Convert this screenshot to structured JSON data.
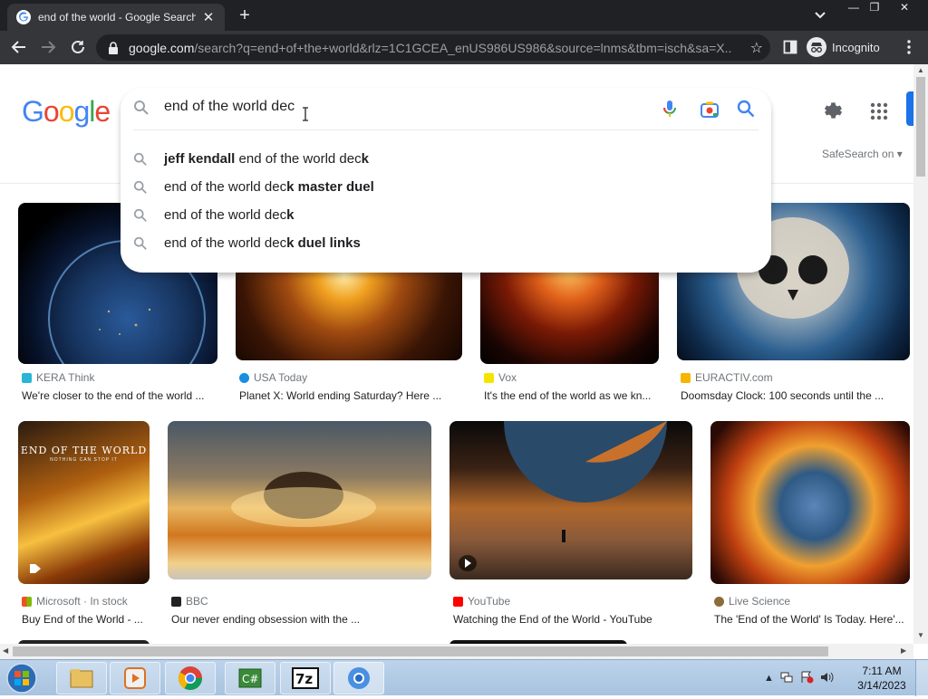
{
  "browser": {
    "tab_title": "end of the world - Google Search",
    "tab_close": "✕",
    "new_tab": "+",
    "url_host": "google.com",
    "url_path": "/search?q=end+of+the+world&rlz=1C1GCEA_enUS986US986&source=lnms&tbm=isch&sa=X...",
    "incognito_label": "Incognito",
    "window_controls": [
      "—",
      "❐",
      "✕"
    ]
  },
  "google": {
    "logo_letters": [
      "G",
      "o",
      "o",
      "g",
      "l",
      "e"
    ],
    "logo_colors": [
      "#4285F4",
      "#EA4335",
      "#FBBC05",
      "#4285F4",
      "#34A853",
      "#EA4335"
    ],
    "search_value": "end of the world dec",
    "safesearch_label": "SafeSearch on ▾",
    "suggestions": [
      {
        "bold_prefix": "jeff kendall",
        "normal": " end of the world dec",
        "bold_suffix": "k"
      },
      {
        "bold_prefix": "",
        "normal": "end of the world dec",
        "bold_suffix": "k master duel"
      },
      {
        "bold_prefix": "",
        "normal": "end of the world dec",
        "bold_suffix": "k"
      },
      {
        "bold_prefix": "",
        "normal": "end of the world dec",
        "bold_suffix": "k duel links"
      }
    ]
  },
  "results": [
    {
      "source": "KERA Think",
      "caption": "We're closer to the end of the world ...",
      "fav_color": "#29b6d6"
    },
    {
      "source": "USA Today",
      "caption": "Planet X: World ending Saturday? Here ...",
      "fav_color": "#1a8ee0"
    },
    {
      "source": "Vox",
      "caption": "It's the end of the world as we kn...",
      "fav_color": "#f5e400"
    },
    {
      "source": "EURACTIV.com",
      "caption": "Doomsday Clock: 100 seconds until the ...",
      "fav_color": "#f7b500"
    },
    {
      "source": "Microsoft · In stock",
      "caption": "Buy End of the World - ...",
      "fav_color": "#f25022"
    },
    {
      "source": "BBC",
      "caption": "Our never ending obsession with the ...",
      "fav_color": "#222222"
    },
    {
      "source": "YouTube",
      "caption": "Watching the End of the World - YouTube",
      "fav_color": "#ff0000"
    },
    {
      "source": "Live Science",
      "caption": "The 'End of the World' Is Today. Here'...",
      "fav_color": "#8a6d3b"
    }
  ],
  "thumb_text": {
    "album_title": "END OF THE WORLD",
    "album_subtitle": "NOTHING CAN STOP IT"
  },
  "taskbar": {
    "time": "7:11 AM",
    "date": "3/14/2023"
  }
}
